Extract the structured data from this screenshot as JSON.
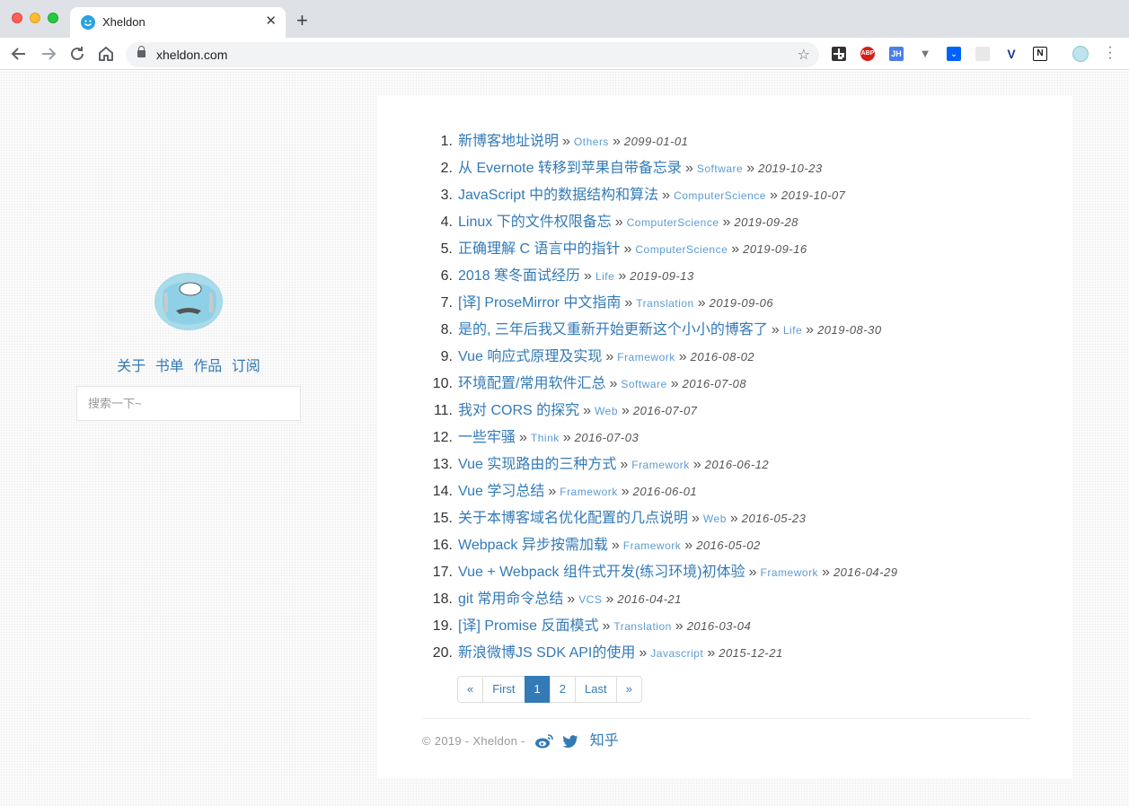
{
  "browser": {
    "tab_title": "Xheldon",
    "url": "xheldon.com",
    "extensions": [
      "qr-code-icon",
      "adblock-plus-icon",
      "json-handle-icon",
      "vue-devtools-icon",
      "dropbox-icon",
      "extension-icon",
      "vimium-icon",
      "notion-icon",
      "profile-avatar-icon"
    ]
  },
  "sidebar": {
    "links": [
      "关于",
      "书单",
      "作品",
      "订阅"
    ],
    "search_placeholder": "搜索一下~"
  },
  "posts": [
    {
      "num": "1.",
      "title": "新博客地址说明",
      "category": "Others",
      "date": "2099-01-01"
    },
    {
      "num": "2.",
      "title": "从 Evernote 转移到苹果自带备忘录",
      "category": "Software",
      "date": "2019-10-23"
    },
    {
      "num": "3.",
      "title": "JavaScript 中的数据结构和算法",
      "category": "ComputerScience",
      "date": "2019-10-07"
    },
    {
      "num": "4.",
      "title": "Linux 下的文件权限备忘",
      "category": "ComputerScience",
      "date": "2019-09-28"
    },
    {
      "num": "5.",
      "title": "正确理解 C 语言中的指针",
      "category": "ComputerScience",
      "date": "2019-09-16"
    },
    {
      "num": "6.",
      "title": "2018 寒冬面试经历",
      "category": "Life",
      "date": "2019-09-13"
    },
    {
      "num": "7.",
      "title": "[译] ProseMirror 中文指南",
      "category": "Translation",
      "date": "2019-09-06"
    },
    {
      "num": "8.",
      "title": "是的, 三年后我又重新开始更新这个小小的博客了",
      "category": "Life",
      "date": "2019-08-30"
    },
    {
      "num": "9.",
      "title": "Vue 响应式原理及实现",
      "category": "Framework",
      "date": "2016-08-02"
    },
    {
      "num": "10.",
      "title": "环境配置/常用软件汇总",
      "category": "Software",
      "date": "2016-07-08"
    },
    {
      "num": "11.",
      "title": "我对 CORS 的探究",
      "category": "Web",
      "date": "2016-07-07"
    },
    {
      "num": "12.",
      "title": "一些牢骚",
      "category": "Think",
      "date": "2016-07-03"
    },
    {
      "num": "13.",
      "title": "Vue 实现路由的三种方式",
      "category": "Framework",
      "date": "2016-06-12"
    },
    {
      "num": "14.",
      "title": "Vue 学习总结",
      "category": "Framework",
      "date": "2016-06-01"
    },
    {
      "num": "15.",
      "title": "关于本博客域名优化配置的几点说明",
      "category": "Web",
      "date": "2016-05-23"
    },
    {
      "num": "16.",
      "title": "Webpack 异步按需加载",
      "category": "Framework",
      "date": "2016-05-02"
    },
    {
      "num": "17.",
      "title": "Vue + Webpack 组件式开发(练习环境)初体验",
      "category": "Framework",
      "date": "2016-04-29"
    },
    {
      "num": "18.",
      "title": "git 常用命令总结",
      "category": "VCS",
      "date": "2016-04-21"
    },
    {
      "num": "19.",
      "title": "[译] Promise 反面模式",
      "category": "Translation",
      "date": "2016-03-04"
    },
    {
      "num": "20.",
      "title": "新浪微博JS SDK API的使用",
      "category": "Javascript",
      "date": "2015-12-21"
    }
  ],
  "separator": "»",
  "pagination": [
    {
      "label": "«",
      "active": false
    },
    {
      "label": "First",
      "active": false
    },
    {
      "label": "1",
      "active": true
    },
    {
      "label": "2",
      "active": false
    },
    {
      "label": "Last",
      "active": false
    },
    {
      "label": "»",
      "active": false
    }
  ],
  "footer": {
    "copyright": "© 2019 - Xheldon -",
    "zhihu": "知乎"
  },
  "colors": {
    "link": "#337ab7",
    "category": "#5b9bd5",
    "active_page": "#337ab7"
  }
}
